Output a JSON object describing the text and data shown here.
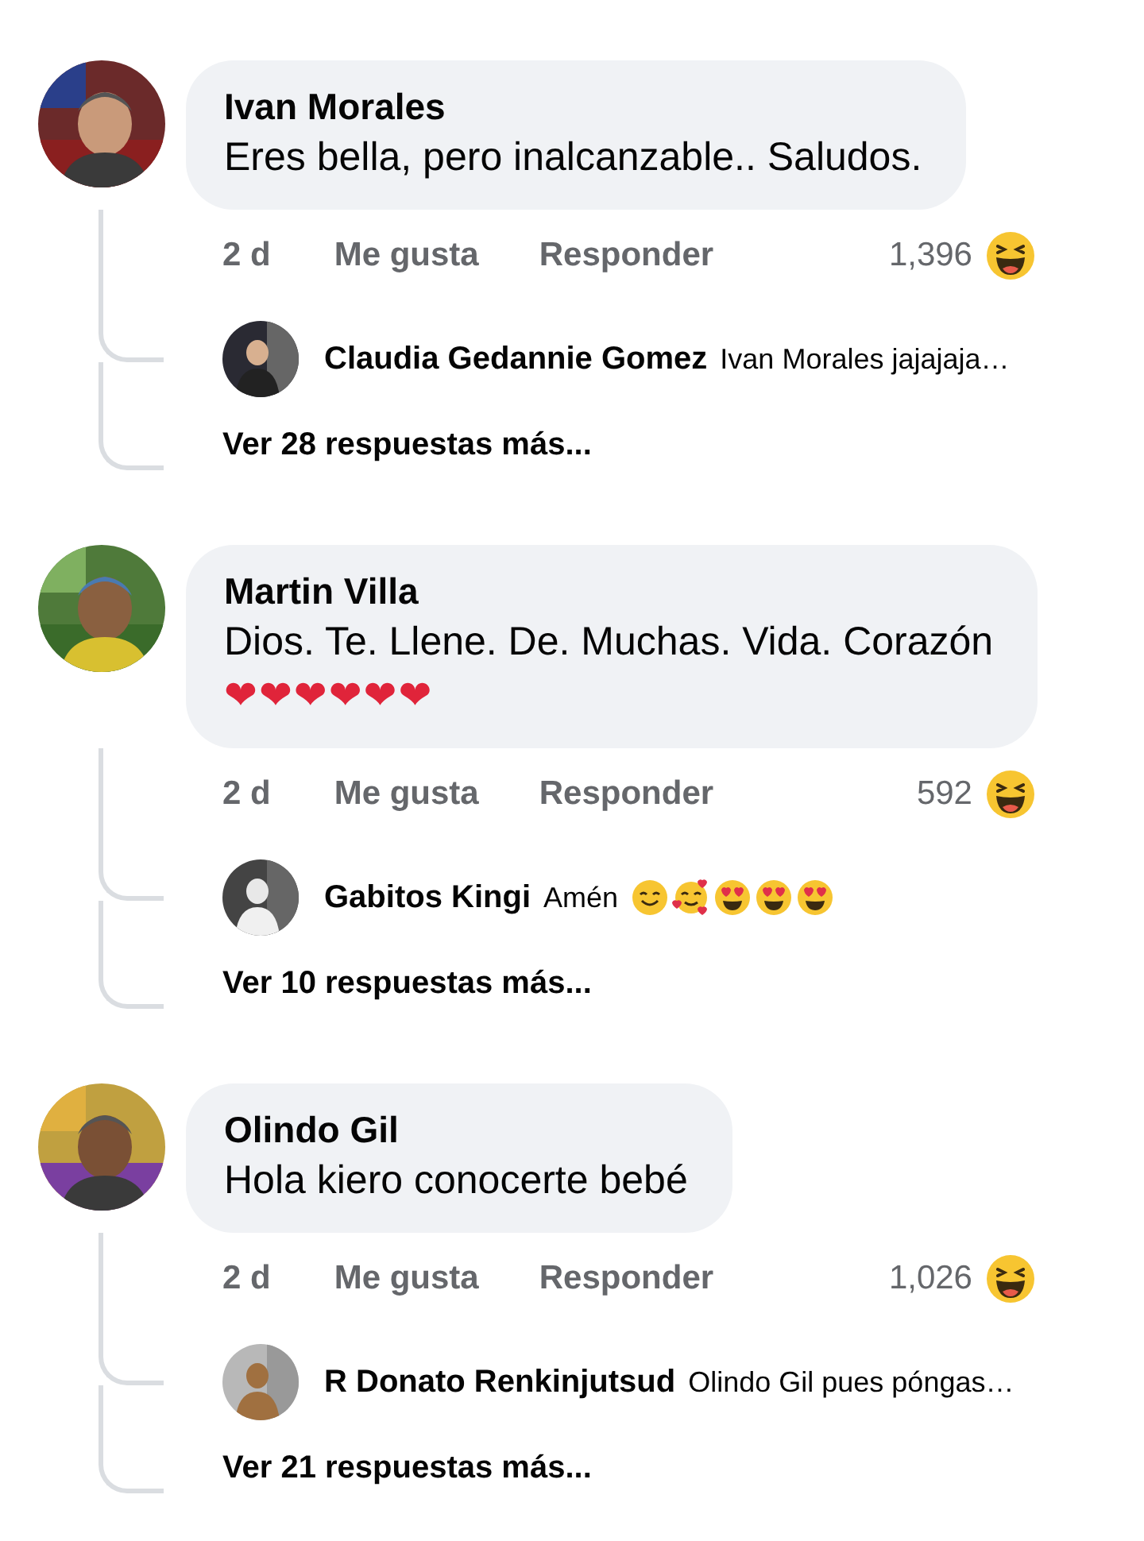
{
  "comments": [
    {
      "name": "Ivan Morales",
      "lines": [
        "Eres bella, pero inalcanzable.. Saludos."
      ],
      "time": "2 d",
      "like": "Me gusta",
      "reply": "Responder",
      "reaction_count": "1,396",
      "reaction": {
        "kind": "laughing"
      },
      "replies": [
        {
          "name": "Claudia Gedannie Gomez",
          "text": "Ivan Morales jajajaja…"
        }
      ],
      "more_replies": "Ver 28 respuestas más..."
    },
    {
      "name": "Martin Villa",
      "lines": [
        "Dios. Te. Llene. De. Muchas. Vida. Corazón"
      ],
      "hearts": "❤❤❤❤❤❤",
      "time": "2 d",
      "like": "Me gusta",
      "reply": "Responder",
      "reaction_count": "592",
      "reaction": {
        "kind": "laughing"
      },
      "replies": [
        {
          "name": "Gabitos Kingi",
          "text": "Amén",
          "emojis": [
            {
              "kind": "smiling"
            },
            {
              "kind": "smiling-hearts"
            },
            {
              "kind": "heart-eyes"
            },
            {
              "kind": "heart-eyes"
            },
            {
              "kind": "heart-eyes"
            }
          ]
        }
      ],
      "more_replies": "Ver 10 respuestas más..."
    },
    {
      "name": "Olindo Gil",
      "lines": [
        "Hola kiero conocerte bebé"
      ],
      "time": "2 d",
      "like": "Me gusta",
      "reply": "Responder",
      "reaction_count": "1,026",
      "reaction": {
        "kind": "laughing"
      },
      "replies": [
        {
          "name": "R Donato Renkinjutsud",
          "text": "Olindo Gil pues póngas…"
        }
      ],
      "more_replies": "Ver 21 respuestas más..."
    }
  ]
}
